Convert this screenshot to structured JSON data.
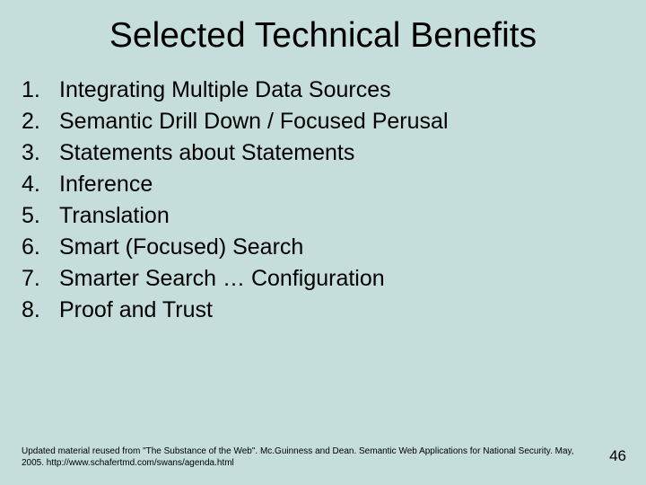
{
  "title": "Selected Technical Benefits",
  "items": [
    {
      "num": "1.",
      "text": "Integrating Multiple Data Sources"
    },
    {
      "num": "2.",
      "text": "Semantic Drill Down / Focused Perusal"
    },
    {
      "num": "3.",
      "text": "Statements about Statements"
    },
    {
      "num": "4.",
      "text": "Inference"
    },
    {
      "num": "5.",
      "text": "Translation"
    },
    {
      "num": "6.",
      "text": "Smart (Focused) Search"
    },
    {
      "num": "7.",
      "text": "Smarter Search … Configuration"
    },
    {
      "num": "8.",
      "text": "Proof and Trust"
    }
  ],
  "footer": "Updated material reused from \"The Substance of the Web\". Mc.Guinness and Dean. Semantic Web Applications for National Security. May, 2005.   http://www.schafertmd.com/swans/agenda.html",
  "pageNumber": "46"
}
